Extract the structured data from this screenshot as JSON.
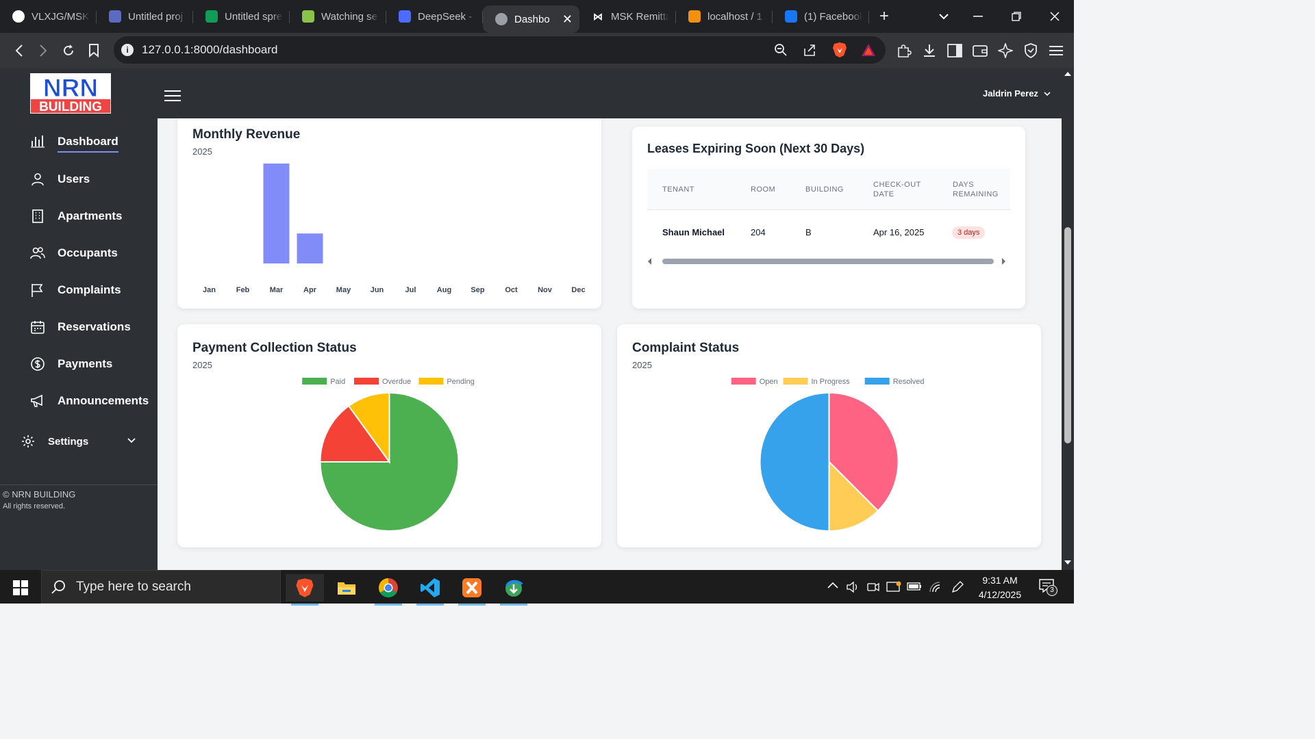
{
  "browser": {
    "tabs": [
      {
        "title": "VLXJG/MSK",
        "icon": "github-icon"
      },
      {
        "title": "Untitled proj",
        "icon": "project-icon"
      },
      {
        "title": "Untitled spre",
        "icon": "sheets-icon"
      },
      {
        "title": "Watching se",
        "icon": "frog-icon"
      },
      {
        "title": "DeepSeek -",
        "icon": "deepseek-icon"
      },
      {
        "title": "Dashbo",
        "icon": "globe-icon",
        "active": true
      },
      {
        "title": "MSK Remitta",
        "icon": "bowtie-icon"
      },
      {
        "title": "localhost / 1",
        "icon": "phpmyadmin-icon"
      },
      {
        "title": "(1) Facebook",
        "icon": "facebook-icon"
      }
    ],
    "new_tab": "+",
    "url": "127.0.0.1:8000/dashboard"
  },
  "app": {
    "logo_top": "NRN",
    "logo_bottom": "BUILDING",
    "user_name": "Jaldrin Perez"
  },
  "sidebar": {
    "items": [
      {
        "label": "Dashboard",
        "icon": "bar-chart-icon",
        "active": true
      },
      {
        "label": "Users",
        "icon": "user-icon"
      },
      {
        "label": "Apartments",
        "icon": "building-icon"
      },
      {
        "label": "Occupants",
        "icon": "users-icon"
      },
      {
        "label": "Complaints",
        "icon": "flag-icon"
      },
      {
        "label": "Reservations",
        "icon": "calendar-icon"
      },
      {
        "label": "Payments",
        "icon": "dollar-icon"
      },
      {
        "label": "Announcements",
        "icon": "megaphone-icon"
      }
    ],
    "settings_label": "Settings",
    "copyright": "© NRN BUILDING",
    "rights": "All rights reserved."
  },
  "revenue_card": {
    "title": "Monthly Revenue",
    "year": "2025"
  },
  "leases_card": {
    "title": "Leases Expiring Soon (Next 30 Days)",
    "columns": [
      "Tenant",
      "Room",
      "Building",
      "Check-out Date",
      "Days Remaining"
    ],
    "rows": [
      {
        "tenant": "Shaun Michael",
        "room": "204",
        "building": "B",
        "checkout": "Apr 16, 2025",
        "days": "3 days"
      }
    ]
  },
  "payment_card": {
    "title": "Payment Collection Status",
    "year": "2025"
  },
  "complaint_card": {
    "title": "Complaint Status",
    "year": "2025"
  },
  "chart_data": [
    {
      "type": "bar",
      "title": "Monthly Revenue",
      "categories": [
        "Jan",
        "Feb",
        "Mar",
        "Apr",
        "May",
        "Jun",
        "Jul",
        "Aug",
        "Sep",
        "Oct",
        "Nov",
        "Dec"
      ],
      "values": [
        0,
        0,
        100,
        30,
        0,
        0,
        0,
        0,
        0,
        0,
        0,
        0
      ],
      "ylim": [
        0,
        100
      ],
      "color": "#818cf8",
      "grid": false
    },
    {
      "type": "pie",
      "title": "Payment Collection Status",
      "labels": [
        "Paid",
        "Overdue",
        "Pending"
      ],
      "values": [
        75,
        15,
        10
      ],
      "colors": [
        "#4caf50",
        "#f44336",
        "#ffc107"
      ],
      "legend": "top"
    },
    {
      "type": "pie",
      "title": "Complaint Status",
      "labels": [
        "Open",
        "In Progress",
        "Resolved"
      ],
      "values": [
        37.5,
        12.5,
        50
      ],
      "colors": [
        "#ff6384",
        "#ffcd56",
        "#36a2eb"
      ],
      "legend": "top"
    }
  ],
  "taskbar": {
    "search_placeholder": "Type here to search",
    "time": "9:31 AM",
    "date": "4/12/2025",
    "notification_count": "3"
  }
}
